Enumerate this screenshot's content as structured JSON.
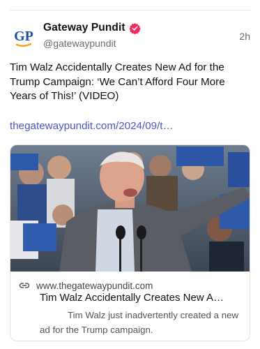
{
  "post": {
    "author_name": "Gateway Pundit",
    "avatar_text": "GP",
    "handle": "@gatewaypundit",
    "time": "2h",
    "text": "Tim Walz Accidentally Creates New Ad for the Trump Campaign: ‘We Can’t Afford Four More Years of This!’ (VIDEO)",
    "link": "thegatewaypundit.com/2024/09/t…"
  },
  "card": {
    "domain": "www.thegatewaypundit.com",
    "title": "Tim Walz Accidentally Creates New A…",
    "description": "Tim Walz just inadvertently created a new ad for the Trump campaign."
  },
  "colors": {
    "link": "#4a58c9",
    "verified": "#ee2c5e",
    "avatar_blue": "#1f4fa6",
    "avatar_orange": "#f0a31c"
  }
}
